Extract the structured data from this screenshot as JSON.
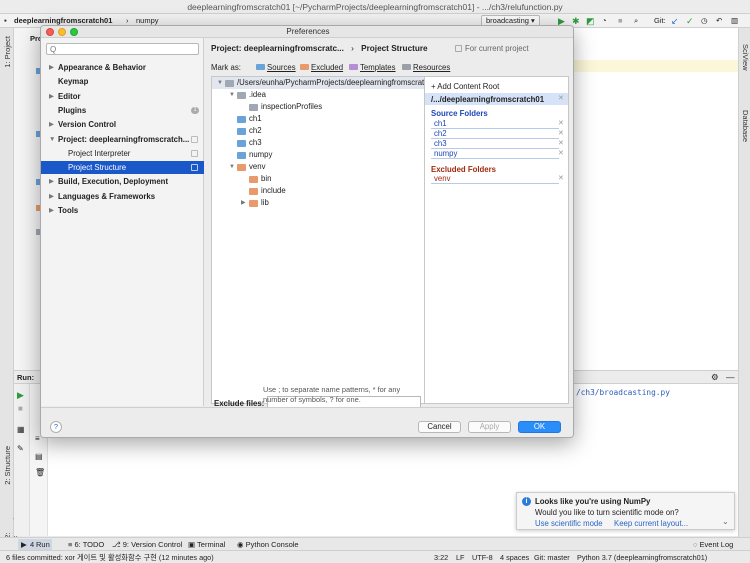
{
  "ide": {
    "window_title": "deeplearningfromscratch01 [~/PycharmProjects/deeplearningfromscratch01] - .../ch3/relufunction.py",
    "breadcrumb": [
      "deeplearningfromscratch01",
      "numpy"
    ],
    "run_config": "broadcasting",
    "git_label": "Git:",
    "left_tabs": [
      "1: Project",
      "2: Structure",
      "2: Favorites"
    ],
    "right_tabs": [
      "SciView",
      "Database"
    ],
    "project_label_partial": "Pro",
    "run_label": "Run:",
    "run_output_path": "/ch3/broadcasting.py",
    "tool_windows": [
      {
        "num": "4",
        "label": "Run"
      },
      {
        "num": "6",
        "label": "TODO"
      },
      {
        "num": "9",
        "label": "Version Control"
      },
      {
        "num": "",
        "label": "Terminal"
      },
      {
        "num": "",
        "label": "Python Console"
      }
    ],
    "event_log": "Event Log",
    "status_left": "6 files committed: xor 게이트 및 활성화함수 구현 (12 minutes ago)",
    "status_right": [
      "3:22",
      "LF",
      "UTF-8",
      "4 spaces",
      "Git: master",
      "Python 3.7 (deeplearningfromscratch01)"
    ]
  },
  "dialog": {
    "title": "Preferences",
    "search_placeholder": "Q",
    "nav": [
      {
        "label": "Appearance & Behavior",
        "bold": true,
        "arrow": "▶"
      },
      {
        "label": "Keymap",
        "bold": true,
        "arrow": ""
      },
      {
        "label": "Editor",
        "bold": true,
        "arrow": "▶"
      },
      {
        "label": "Plugins",
        "bold": true,
        "arrow": "",
        "badge": "1"
      },
      {
        "label": "Version Control",
        "bold": true,
        "arrow": "▶"
      },
      {
        "label": "Project: deeplearningfromscratch...",
        "bold": true,
        "arrow": "▼"
      },
      {
        "label": "Project Interpreter",
        "bold": false,
        "arrow": "",
        "sub": true
      },
      {
        "label": "Project Structure",
        "bold": false,
        "arrow": "",
        "sub": true,
        "selected": true
      },
      {
        "label": "Build, Execution, Deployment",
        "bold": true,
        "arrow": "▶"
      },
      {
        "label": "Languages & Frameworks",
        "bold": true,
        "arrow": "▶"
      },
      {
        "label": "Tools",
        "bold": true,
        "arrow": "▶"
      }
    ],
    "header_project": "Project: deeplearningfromscratc...",
    "header_sep": "›",
    "header_page": "Project Structure",
    "for_current_project": "For current project",
    "mark_as": "Mark as:",
    "mark_buttons": [
      {
        "label": "Sources",
        "color": "#6aa3d8"
      },
      {
        "label": "Excluded",
        "color": "#e89a6d"
      },
      {
        "label": "Templates",
        "color": "#b48fd6"
      },
      {
        "label": "Resources",
        "color": "#9aa0a6"
      }
    ],
    "tree": [
      {
        "name": "/Users/eunha/PycharmProjects/deeplearningfromscratch01",
        "level": 0,
        "arrow": "▼",
        "color": "#a0a8b4"
      },
      {
        "name": ".idea",
        "level": 1,
        "arrow": "▼",
        "color": "#a0a8b4"
      },
      {
        "name": "inspectionProfiles",
        "level": 2,
        "arrow": "",
        "color": "#a0a8b4"
      },
      {
        "name": "ch1",
        "level": 1,
        "arrow": "",
        "color": "#6aa3d8"
      },
      {
        "name": "ch2",
        "level": 1,
        "arrow": "",
        "color": "#6aa3d8"
      },
      {
        "name": "ch3",
        "level": 1,
        "arrow": "",
        "color": "#6aa3d8"
      },
      {
        "name": "numpy",
        "level": 1,
        "arrow": "",
        "color": "#6aa3d8"
      },
      {
        "name": "venv",
        "level": 1,
        "arrow": "▼",
        "color": "#e89a6d"
      },
      {
        "name": "bin",
        "level": 2,
        "arrow": "",
        "color": "#e89a6d"
      },
      {
        "name": "include",
        "level": 2,
        "arrow": "",
        "color": "#e89a6d"
      },
      {
        "name": "lib",
        "level": 2,
        "arrow": "▶",
        "color": "#e89a6d"
      }
    ],
    "add_content_root": "+ Add Content Root",
    "content_root": "/.../deeplearningfromscratch01",
    "source_folders_title": "Source Folders",
    "source_folders": [
      "ch1",
      "ch2",
      "ch3",
      "numpy"
    ],
    "excluded_folders_title": "Excluded Folders",
    "excluded_folders": [
      "venv"
    ],
    "exclude_files_label": "Exclude files:",
    "exclude_files_value": "",
    "exclude_hint": "Use ; to separate name patterns, * for any number of symbols, ? for one.",
    "cancel": "Cancel",
    "apply": "Apply",
    "ok": "OK",
    "help": "?"
  },
  "notification": {
    "title": "Looks like you're using NumPy",
    "body": "Would you like to turn scientific mode on?",
    "action1": "Use scientific mode",
    "action2": "Keep current layout...",
    "chevron": "⌄"
  },
  "colors": {
    "selection": "#1a57c9",
    "source": "#1c47b5",
    "excluded": "#a3290f",
    "ok_button": "#2b8df7"
  }
}
